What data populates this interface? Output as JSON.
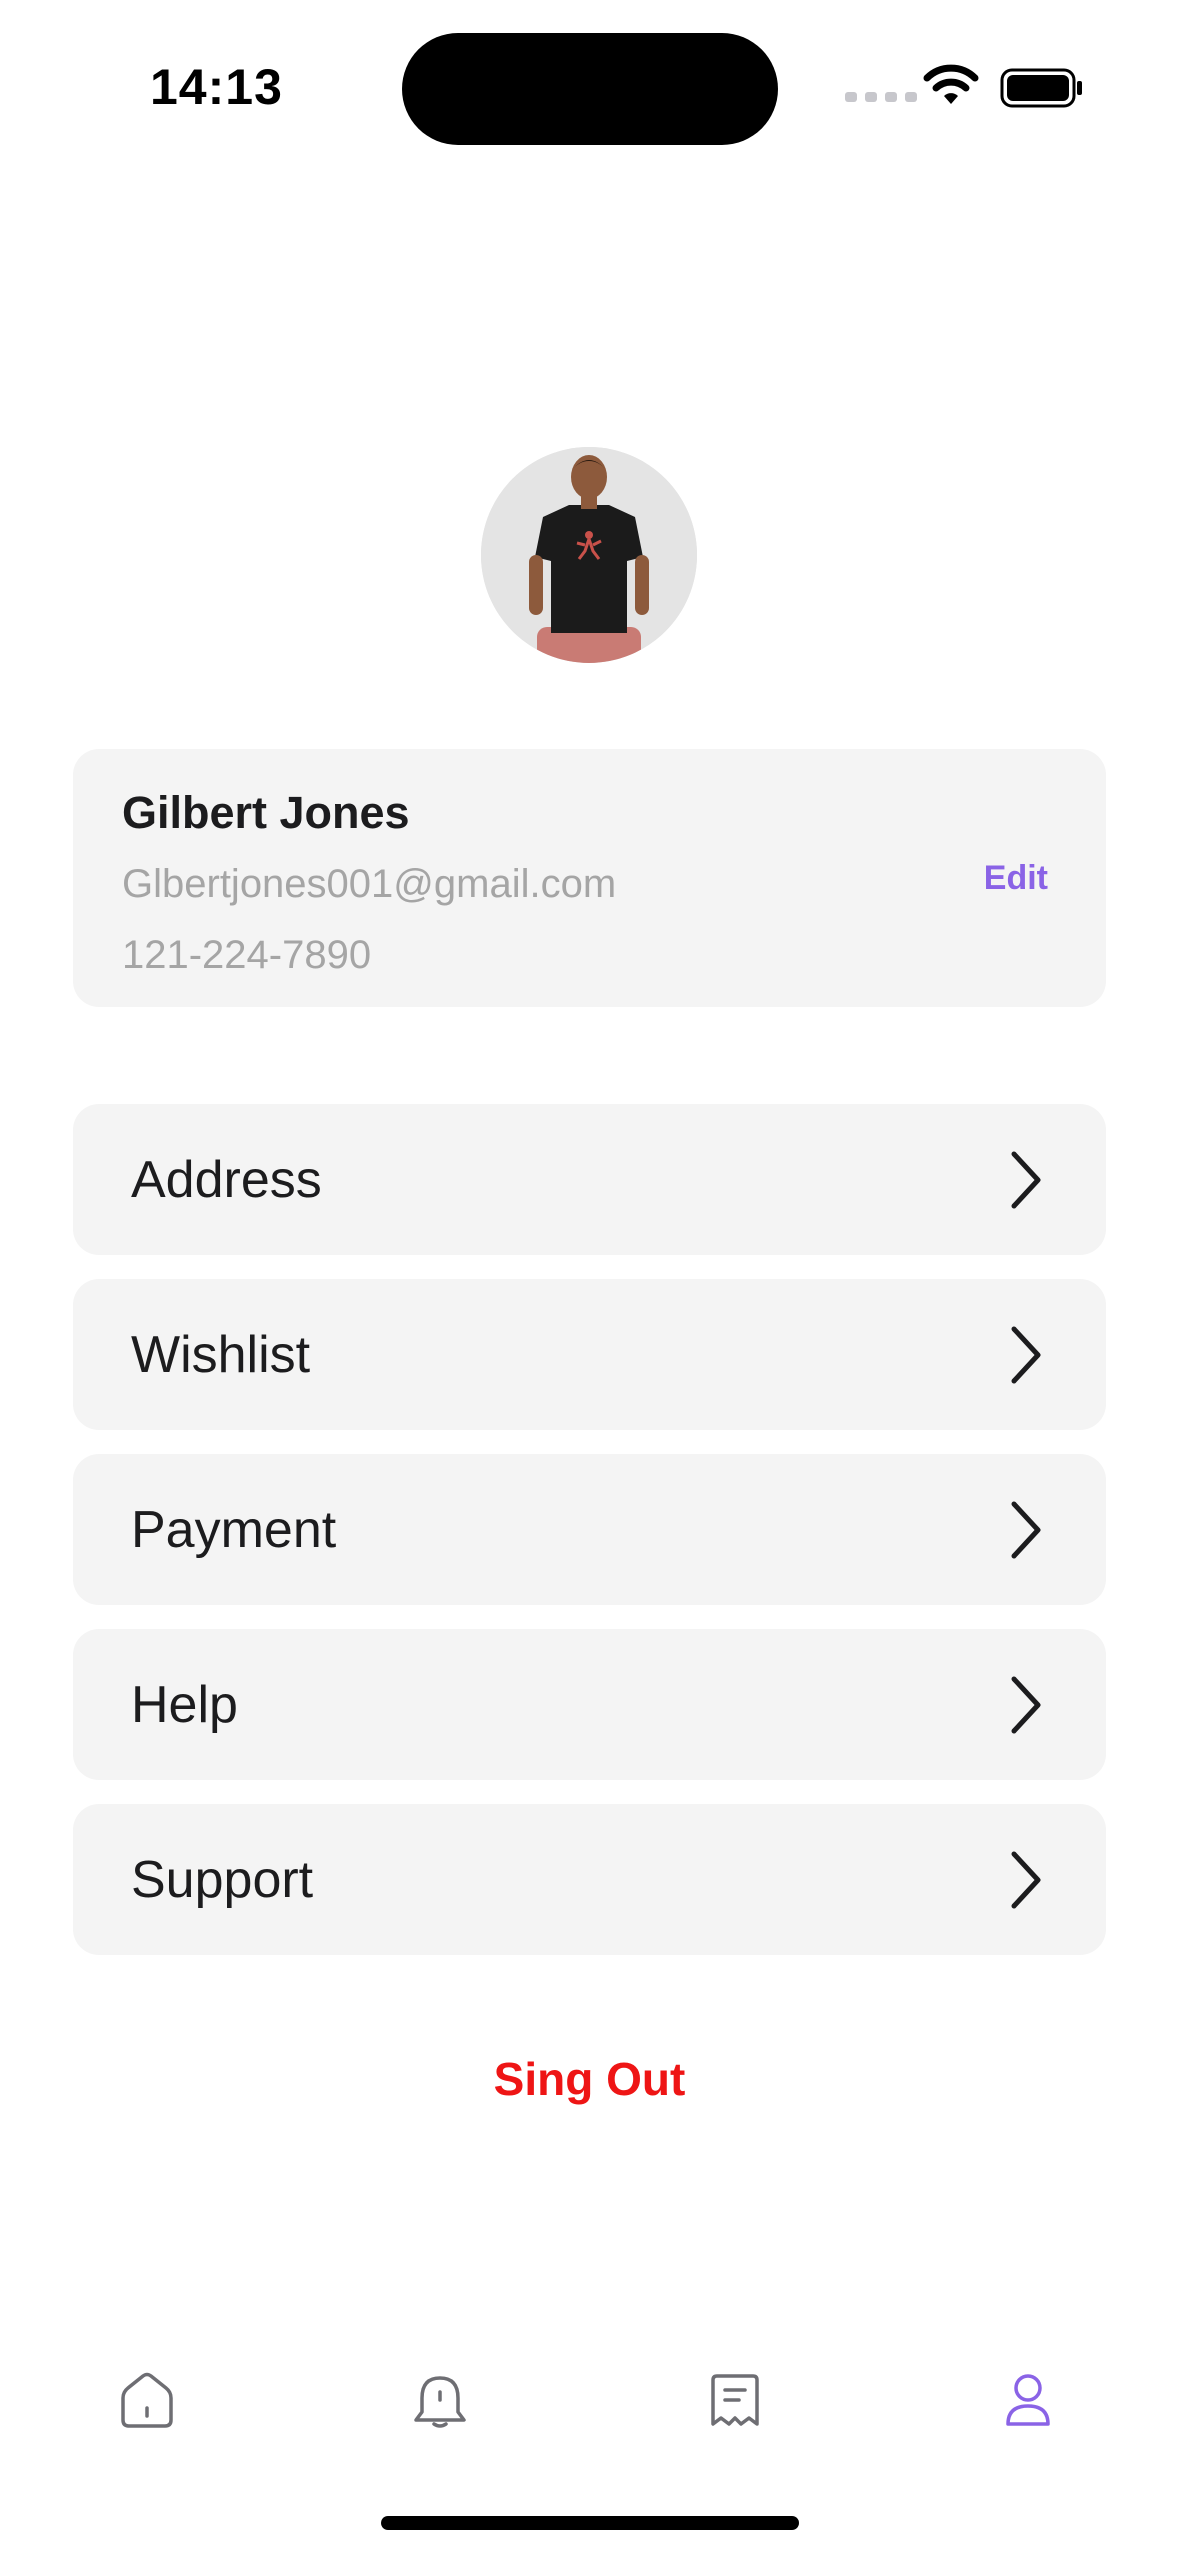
{
  "status_bar": {
    "time": "14:13"
  },
  "profile": {
    "name": "Gilbert Jones",
    "email": "Glbertjones001@gmail.com",
    "phone": "121-224-7890",
    "edit_label": "Edit"
  },
  "menu": {
    "items": [
      {
        "label": "Address"
      },
      {
        "label": "Wishlist"
      },
      {
        "label": "Payment"
      },
      {
        "label": "Help"
      },
      {
        "label": "Support"
      }
    ]
  },
  "signout_label": "Sing Out",
  "tab_bar": {
    "items": [
      {
        "icon": "home-icon",
        "active": false
      },
      {
        "icon": "notification-bell-icon",
        "active": false
      },
      {
        "icon": "orders-receipt-icon",
        "active": false
      },
      {
        "icon": "profile-icon",
        "active": true
      }
    ]
  },
  "colors": {
    "accent": "#8a63e6",
    "danger": "#ee1515",
    "card": "#f4f4f4",
    "muted": "#a5a5a5"
  }
}
